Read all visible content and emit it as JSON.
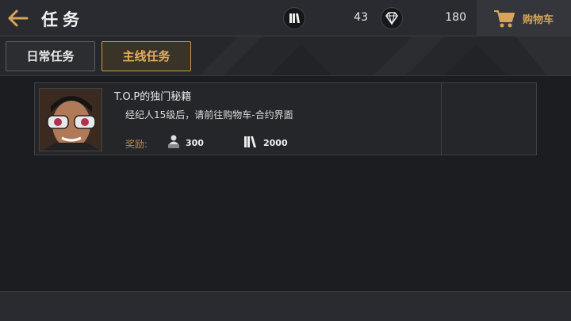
{
  "header": {
    "title": "任务",
    "currency_1_value": "43",
    "currency_2_value": "180",
    "cart_label": "购物车"
  },
  "tabs": [
    {
      "label": "日常任务",
      "active": false
    },
    {
      "label": "主线任务",
      "active": true
    }
  ],
  "quests": [
    {
      "title": "T.O.P的独门秘籍",
      "description": "经纪人15级后，请前往购物车-合约界面",
      "reward_label": "奖励:",
      "rewards": [
        {
          "icon": "exp-icon",
          "value": "300"
        },
        {
          "icon": "books-icon",
          "value": "2000"
        }
      ]
    }
  ],
  "colors": {
    "accent": "#d8a457",
    "background": "#1c1d21",
    "panel": "#25262a"
  }
}
